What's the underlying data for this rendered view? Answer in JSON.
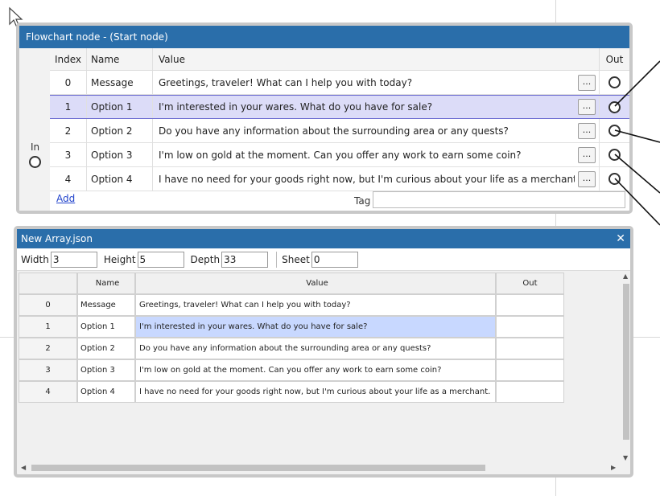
{
  "node": {
    "title": "Flowchart node - (Start node)",
    "in_label": "In",
    "columns": {
      "index": "Index",
      "name": "Name",
      "value": "Value",
      "out": "Out"
    },
    "rows": [
      {
        "index": "0",
        "name": "Message",
        "value": "Greetings, traveler! What can I help you with today?",
        "button": "..."
      },
      {
        "index": "1",
        "name": "Option 1",
        "value": "I'm interested in your wares. What do you have for sale?",
        "button": "..."
      },
      {
        "index": "2",
        "name": "Option 2",
        "value": "Do you have any information about the surrounding area or any quests?",
        "button": "..."
      },
      {
        "index": "3",
        "name": "Option 3",
        "value": "I'm low on gold at the moment. Can you offer any work to earn some coin?",
        "button": "..."
      },
      {
        "index": "4",
        "name": "Option 4",
        "value": "I have no need for your goods right now, but I'm curious about your life as a merchant.",
        "button": "..."
      }
    ],
    "selected_row": 1,
    "add_label": "Add",
    "tag_label": "Tag",
    "tag_value": ""
  },
  "json_window": {
    "title": "New Array.json",
    "close_icon": "close-icon",
    "toolbar": {
      "width_label": "Width",
      "width_value": "3",
      "height_label": "Height",
      "height_value": "5",
      "depth_label": "Depth",
      "depth_value": "33",
      "sheet_label": "Sheet",
      "sheet_value": "0"
    },
    "columns": {
      "name": "Name",
      "value": "Value",
      "out": "Out"
    },
    "rows": [
      {
        "index": "0",
        "name": "Message",
        "value": "Greetings, traveler! What can I help you with today?",
        "out": ""
      },
      {
        "index": "1",
        "name": "Option 1",
        "value": "I'm interested in your wares. What do you have for sale?",
        "out": ""
      },
      {
        "index": "2",
        "name": "Option 2",
        "value": "Do you have any information about the surrounding area or any quests?",
        "out": ""
      },
      {
        "index": "3",
        "name": "Option 3",
        "value": "I'm low on gold at the moment. Can you offer any work to earn some coin?",
        "out": ""
      },
      {
        "index": "4",
        "name": "Option 4",
        "value": "I have no need for your goods right now, but I'm curious about your life as a merchant.",
        "out": ""
      }
    ],
    "selected_cell": {
      "row": 1,
      "column": "value"
    }
  },
  "colors": {
    "title_bar": "#2a6eaa",
    "selected_row": "#dcdcf8",
    "selected_cell": "#c8d8ff",
    "link": "#2244cc"
  }
}
